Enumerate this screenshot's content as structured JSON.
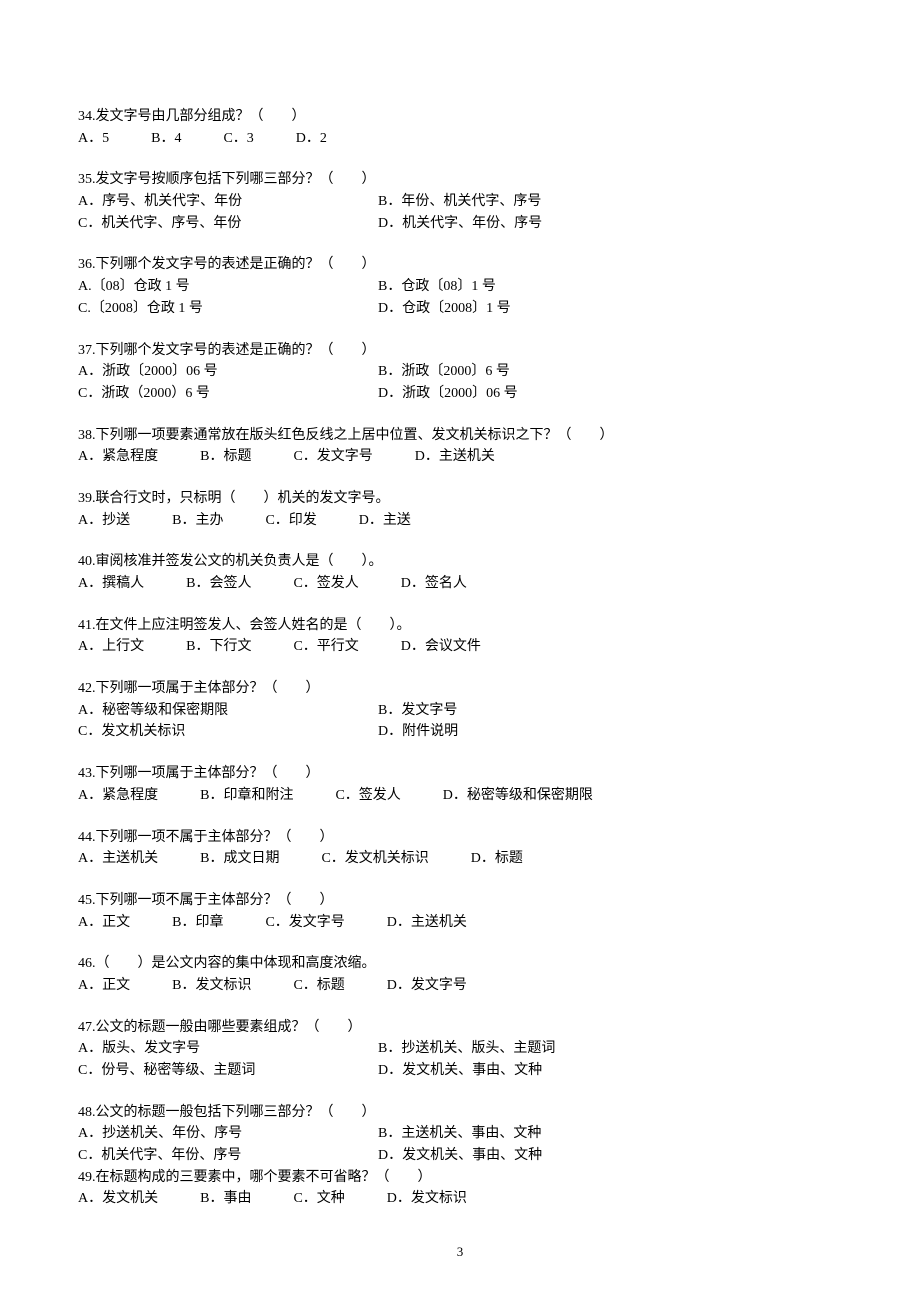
{
  "page_number": "3",
  "questions": [
    {
      "num": "34",
      "stem": "34.发文字号由几部分组成？（　　）",
      "layout": "inline",
      "options_inline": "A．5　　　B．4　　　C．3　　　D．2"
    },
    {
      "num": "35",
      "stem": "35.发文字号按顺序包括下列哪三部分？（　　）",
      "layout": "twocol",
      "rows": [
        {
          "l": "A．序号、机关代字、年份",
          "r": "B．年份、机关代字、序号"
        },
        {
          "l": "C．机关代字、序号、年份",
          "r": "D．机关代字、年份、序号"
        }
      ]
    },
    {
      "num": "36",
      "stem": "36.下列哪个发文字号的表述是正确的？（　　）",
      "layout": "twocol",
      "rows": [
        {
          "l": "A.〔08〕仓政 1 号",
          "r": "B．仓政〔08〕1 号"
        },
        {
          "l": "C.〔2008〕仓政 1 号",
          "r": "D．仓政〔2008〕1 号"
        }
      ]
    },
    {
      "num": "37",
      "stem": "37.下列哪个发文字号的表述是正确的？（　　）",
      "layout": "twocol",
      "rows": [
        {
          "l": "A．浙政〔2000〕06 号",
          "r": "B．浙政〔2000〕6 号"
        },
        {
          "l": "C．浙政（2000）6 号",
          "r": "D．浙政〔2000〕06 号"
        }
      ]
    },
    {
      "num": "38",
      "stem": "38.下列哪一项要素通常放在版头红色反线之上居中位置、发文机关标识之下？（　　）",
      "layout": "inline",
      "options_inline": "A．紧急程度　　　B．标题　　　C．发文字号　　　D．主送机关"
    },
    {
      "num": "39",
      "stem": "39.联合行文时，只标明（　　）机关的发文字号。",
      "layout": "inline",
      "options_inline": "A．抄送　　　B．主办　　　C．印发　　　D．主送"
    },
    {
      "num": "40",
      "stem": "40.审阅核准并签发公文的机关负责人是（　　）。",
      "layout": "inline",
      "options_inline": "A．撰稿人　　　B．会签人　　　C．签发人　　　D．签名人"
    },
    {
      "num": "41",
      "stem": "41.在文件上应注明签发人、会签人姓名的是（　　）。",
      "layout": "inline",
      "options_inline": "A．上行文　　　B．下行文　　　C．平行文　　　D．会议文件"
    },
    {
      "num": "42",
      "stem": "42.下列哪一项属于主体部分？（　　）",
      "layout": "twocol",
      "rows": [
        {
          "l": "A．秘密等级和保密期限",
          "r": "B．发文字号"
        },
        {
          "l": "C．发文机关标识",
          "r": "D．附件说明"
        }
      ]
    },
    {
      "num": "43",
      "stem": "43.下列哪一项属于主体部分？（　　）",
      "layout": "inline",
      "options_inline": "A．紧急程度　　　B．印章和附注　　　C．签发人　　　D．秘密等级和保密期限"
    },
    {
      "num": "44",
      "stem": "44.下列哪一项不属于主体部分？（　　）",
      "layout": "inline",
      "options_inline": "A．主送机关　　　B．成文日期　　　C．发文机关标识　　　D．标题"
    },
    {
      "num": "45",
      "stem": "45.下列哪一项不属于主体部分？（　　）",
      "layout": "inline",
      "options_inline": "A．正文　　　B．印章　　　C．发文字号　　　D．主送机关"
    },
    {
      "num": "46",
      "stem": "46.（　　）是公文内容的集中体现和高度浓缩。",
      "layout": "inline",
      "options_inline": "A．正文　　　B．发文标识　　　C．标题　　　D．发文字号"
    },
    {
      "num": "47",
      "stem": "47.公文的标题一般由哪些要素组成？（　　）",
      "layout": "twocol",
      "rows": [
        {
          "l": "A．版头、发文字号",
          "r": "B．抄送机关、版头、主题词"
        },
        {
          "l": "C．份号、秘密等级、主题词",
          "r": "D．发文机关、事由、文种"
        }
      ]
    },
    {
      "num": "48",
      "stem": "48.公文的标题一般包括下列哪三部分？（　　）",
      "layout": "twocol",
      "rows": [
        {
          "l": "A．抄送机关、年份、序号",
          "r": "B．主送机关、事由、文种"
        },
        {
          "l": "C．机关代字、年份、序号",
          "r": "D．发文机关、事由、文种"
        }
      ]
    },
    {
      "num": "49",
      "stem": "49.在标题构成的三要素中，哪个要素不可省略？（　　）",
      "layout": "inline",
      "options_inline": "A．发文机关　　　B．事由　　　C．文种　　　D．发文标识",
      "compact": true
    }
  ]
}
